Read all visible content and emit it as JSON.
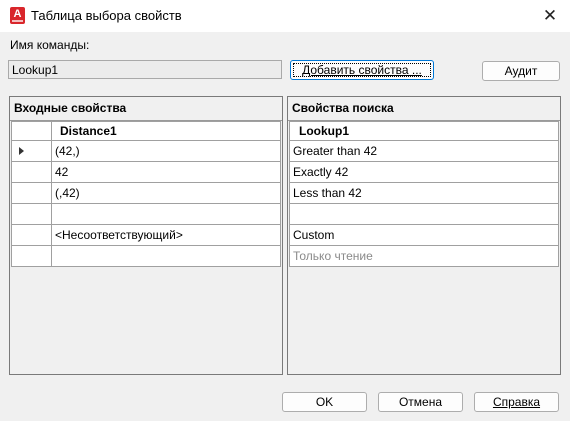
{
  "window": {
    "title": "Таблица выбора свойств",
    "close_symbol": "✕",
    "app_icon_letter": "A"
  },
  "command": {
    "label": "Имя команды:",
    "value": "Lookup1"
  },
  "buttons": {
    "add_properties": "Добавить свойства ...",
    "audit": "Аудит",
    "ok": "OK",
    "cancel": "Отмена",
    "help": "Справка"
  },
  "input_panel": {
    "title": "Входные свойства",
    "column": "Distance1",
    "rows": [
      "(42,)",
      "42",
      "(,42)",
      "",
      "<Несоответствующий>",
      ""
    ]
  },
  "lookup_panel": {
    "title": "Свойства поиска",
    "column": "Lookup1",
    "rows": [
      "Greater than 42",
      "Exactly 42",
      "Less than 42",
      "",
      "Custom",
      "Только чтение"
    ]
  }
}
